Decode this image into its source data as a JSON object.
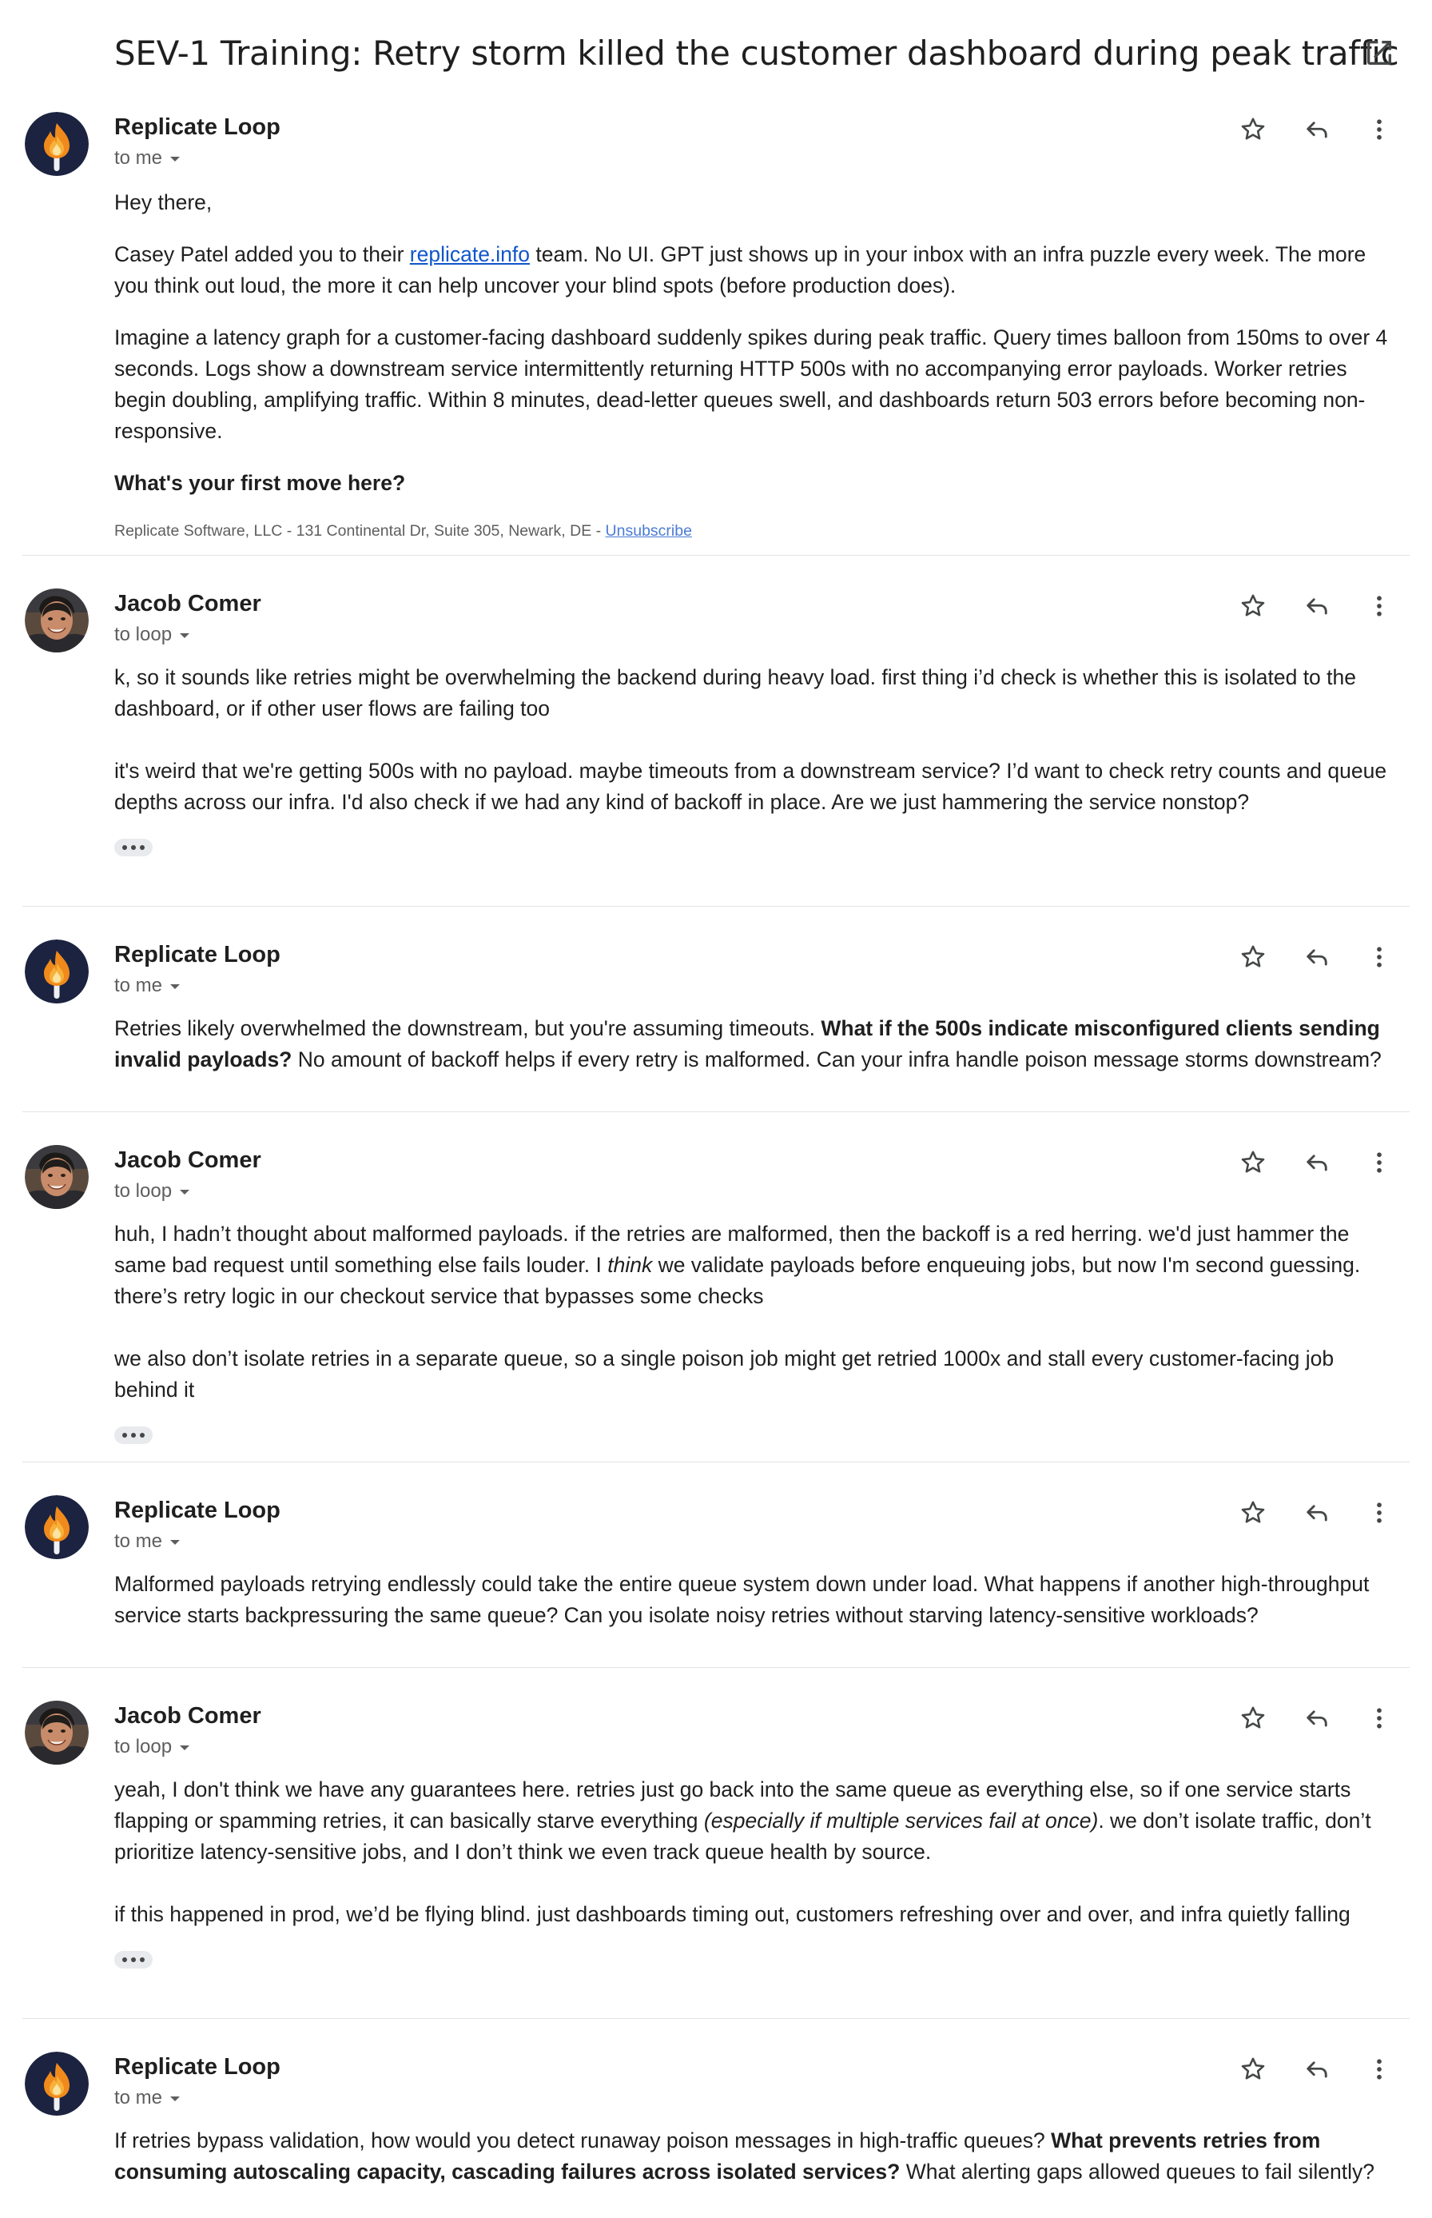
{
  "subject": {
    "title": "SEV-1 Training: Retry storm killed the customer dashboard during peak traffic",
    "open_icon": "open-in-new-window-icon"
  },
  "colors": {
    "text": "#1f1f1f",
    "secondary_text": "#5e5e5e",
    "link": "#1155cc",
    "divider": "#e3e3e3",
    "loop_avatar_bg": "#1b2340",
    "flame_orange": "#f08a1c"
  },
  "messages": [
    {
      "sender": "Replicate Loop",
      "recipient": "to me",
      "avatar_icon": "replicate-flame-logo-icon",
      "greeting": "Hey there,",
      "intro": {
        "before": "Casey Patel added you to their ",
        "link": "replicate.info",
        "after": " team. No UI. GPT just shows up in your inbox with an infra puzzle every week. The more you think out loud, the more it can help uncover your blind spots (before production does)."
      },
      "scenario": "Imagine a latency graph for a customer-facing dashboard suddenly spikes during peak traffic. Query times balloon from 150ms to over 4 seconds. Logs show a downstream service intermittently returning HTTP 500s with no accompanying error payloads. Worker retries begin doubling, amplifying traffic. Within 8 minutes, dead-letter queues swell, and dashboards return 503 errors before becoming non-responsive.",
      "question": "What's your first move here?",
      "footer": {
        "address": "Replicate Software, LLC - 131 Continental Dr, Suite 305, Newark, DE - ",
        "unsubscribe": "Unsubscribe"
      }
    },
    {
      "sender": "Jacob Comer",
      "recipient": "to loop",
      "avatar_icon": "jacob-comer-photo-avatar",
      "p1": "k, so it sounds like retries might be overwhelming the backend during heavy load. first thing i’d check is whether this is isolated to the dashboard, or if other user flows are failing too",
      "p2": "it's weird that we're getting 500s with no payload. maybe timeouts from a downstream service? I’d want to check retry counts and queue depths across our infra. I'd also check if we had any kind of backoff in place. Are we just hammering the service nonstop?"
    },
    {
      "sender": "Replicate Loop",
      "recipient": "to me",
      "avatar_icon": "replicate-flame-logo-icon",
      "pre": "Retries likely overwhelmed the downstream, but you're assuming timeouts. ",
      "bold": "What if the 500s indicate misconfigured clients sending invalid payloads?",
      "post": " No amount of backoff helps if every retry is malformed. Can your infra handle poison message storms downstream?"
    },
    {
      "sender": "Jacob Comer",
      "recipient": "to loop",
      "avatar_icon": "jacob-comer-photo-avatar",
      "p1_pre": "huh, I hadn’t thought about malformed payloads. if the retries are malformed, then the backoff is a red herring. we'd just hammer the same bad request until something else fails louder. I ",
      "p1_italic": "think",
      "p1_post": " we validate payloads before enqueuing jobs, but now I'm second guessing. there’s retry logic in our checkout service that bypasses some checks",
      "p2": "we also don’t isolate retries in a separate queue, so a single poison job might get retried 1000x and stall every customer-facing job behind it"
    },
    {
      "sender": "Replicate Loop",
      "recipient": "to me",
      "avatar_icon": "replicate-flame-logo-icon",
      "text": "Malformed payloads retrying endlessly could take the entire queue system down under load. What happens if another high-throughput service starts backpressuring the same queue? Can you isolate noisy retries without starving latency-sensitive workloads?"
    },
    {
      "sender": "Jacob Comer",
      "recipient": "to loop",
      "avatar_icon": "jacob-comer-photo-avatar",
      "p1_pre": "yeah, I don't think we have any guarantees here. retries just go back into the same queue as everything else, so if one service starts flapping or spamming retries, it can basically starve everything ",
      "p1_italic": "(especially if multiple services fail at once)",
      "p1_post": ". we don’t isolate traffic, don’t prioritize latency-sensitive jobs, and I don’t think we even track queue health by source.",
      "p2": "if this happened in prod, we’d be flying blind. just dashboards timing out, customers refreshing over and over, and infra quietly falling"
    },
    {
      "sender": "Replicate Loop",
      "recipient": "to me",
      "avatar_icon": "replicate-flame-logo-icon",
      "pre": "If retries bypass validation, how would you detect runaway poison messages in high-traffic queues? ",
      "bold": "What prevents retries from consuming autoscaling capacity, cascading failures across isolated services?",
      "post": " What alerting gaps allowed queues to fail silently?"
    }
  ],
  "action_icons": [
    "star-icon",
    "reply-icon",
    "more-vertical-icon"
  ],
  "recipient_icon": "caret-down-icon",
  "collapsed_quote_icon": "show-trimmed-content-icon"
}
